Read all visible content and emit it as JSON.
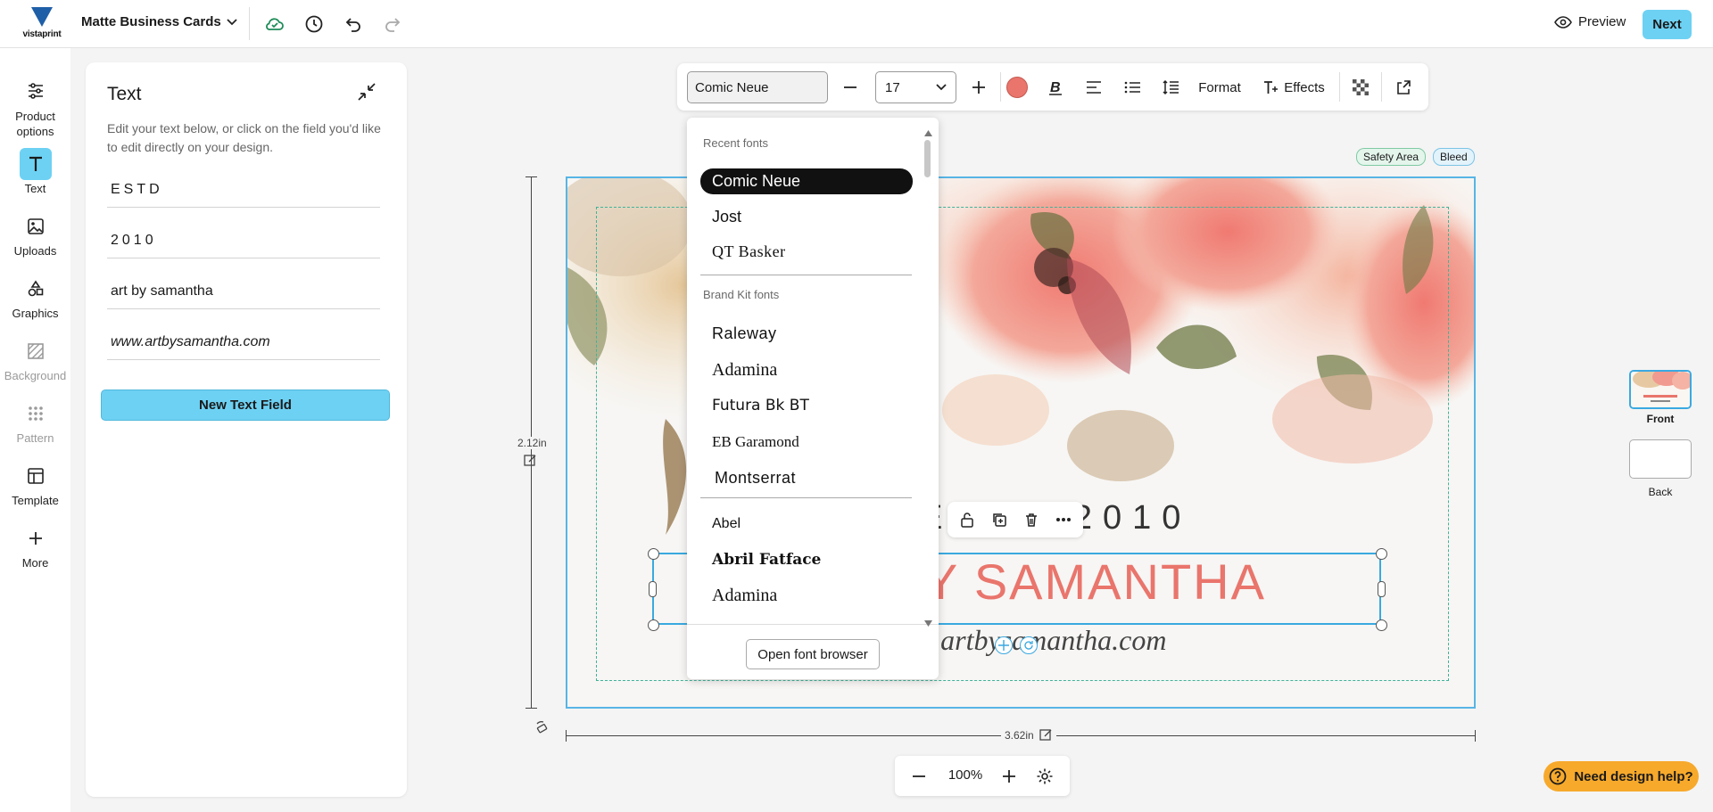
{
  "header": {
    "logo_text": "vistaprint",
    "project_title": "Matte Business Cards",
    "preview_label": "Preview",
    "next_label": "Next"
  },
  "sidebar": {
    "items": [
      {
        "label": "Product options",
        "icon": "sliders-icon"
      },
      {
        "label": "Text",
        "icon": "text-icon"
      },
      {
        "label": "Uploads",
        "icon": "image-icon"
      },
      {
        "label": "Graphics",
        "icon": "shapes-icon"
      },
      {
        "label": "Background",
        "icon": "background-icon"
      },
      {
        "label": "Pattern",
        "icon": "pattern-icon"
      },
      {
        "label": "Template",
        "icon": "template-icon"
      },
      {
        "label": "More",
        "icon": "plus-icon"
      }
    ]
  },
  "text_panel": {
    "title": "Text",
    "help": "Edit your text below, or click on the field you'd like to edit directly on your design.",
    "fields": [
      "ESTD",
      "2010",
      "art by samantha",
      "www.artbysamantha.com"
    ],
    "new_field_label": "New Text Field"
  },
  "toolbar": {
    "font": "Comic Neue",
    "size": "17",
    "text_color": "#e9756c",
    "format_label": "Format",
    "effects_label": "Effects"
  },
  "font_dropdown": {
    "recent_heading": "Recent fonts",
    "recent": [
      "Comic Neue",
      "Jost",
      "QT Basker"
    ],
    "brand_heading": "Brand Kit fonts",
    "brand": [
      "Raleway",
      "Adamina",
      "Futura Bk BT",
      "EB Garamond",
      "Montserrat"
    ],
    "all": [
      "Abel",
      "Abril Fatface",
      "Adamina"
    ],
    "open_browser_label": "Open font browser"
  },
  "canvas": {
    "badge_safety": "Safety Area",
    "badge_bleed": "Bleed",
    "estd_text": "ESTD 2010",
    "name_text": "ART BY SAMANTHA",
    "url_text": "www.artbysamantha.com",
    "height_label": "2.12in",
    "width_label": "3.62in"
  },
  "sides": {
    "front_label": "Front",
    "back_label": "Back"
  },
  "zoom": {
    "value": "100%"
  },
  "help_button": {
    "label": "Need design help?"
  }
}
